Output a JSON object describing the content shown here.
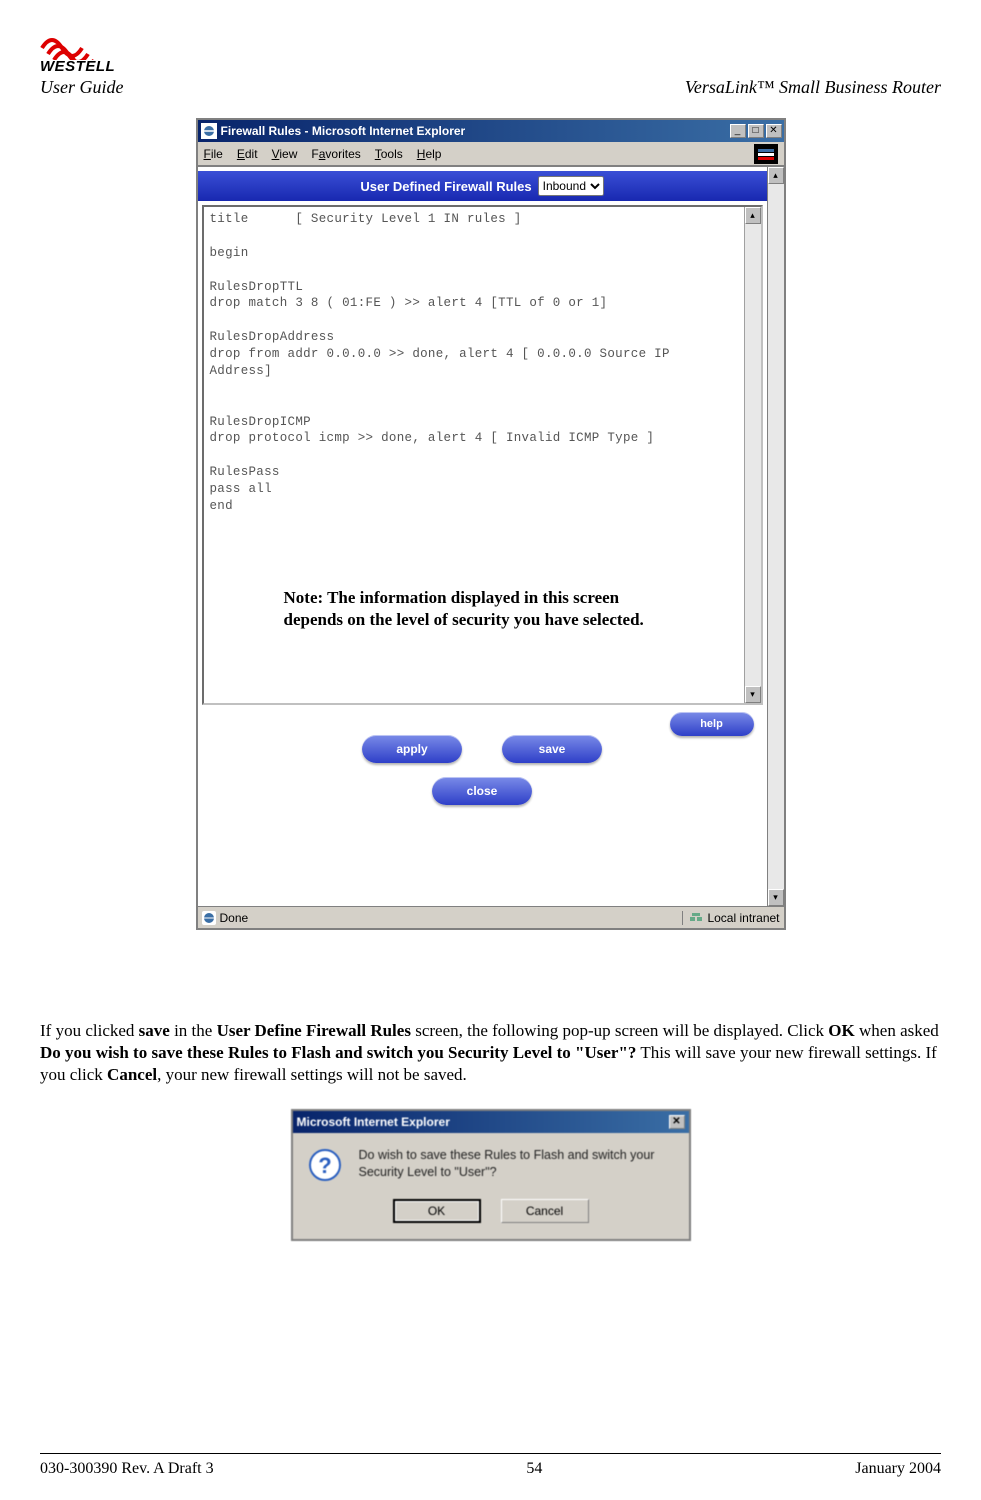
{
  "header": {
    "brand": "WESTELL",
    "user_guide": "User Guide",
    "product": "VersaLink™  Small Business Router"
  },
  "browser": {
    "title": "Firewall Rules - Microsoft Internet Explorer",
    "menu": {
      "file": "File",
      "edit": "Edit",
      "view": "View",
      "favorites": "Favorites",
      "tools": "Tools",
      "help": "Help"
    },
    "status_left": "Done",
    "status_right": "Local intranet"
  },
  "page": {
    "heading": "User Defined Firewall Rules",
    "direction": "Inbound",
    "rules_text": "title      [ Security Level 1 IN rules ]\n\nbegin\n\nRulesDropTTL\ndrop match 3 8 ( 01:FE ) >> alert 4 [TTL of 0 or 1]\n\nRulesDropAddress\ndrop from addr 0.0.0.0 >> done, alert 4 [ 0.0.0.0 Source IP\nAddress]\n\n\nRulesDropICMP\ndrop protocol icmp >> done, alert 4 [ Invalid ICMP Type ]\n\nRulesPass\npass all\nend",
    "note": "Note: The information displayed in this screen depends on the level of security you have selected.",
    "buttons": {
      "apply": "apply",
      "save": "save",
      "close": "close",
      "help": "help"
    }
  },
  "body_paragraph": {
    "p1a": "If you clicked ",
    "p1b": "save",
    "p1c": " in the ",
    "p1d": "User Define Firewall Rules",
    "p1e": " screen, the following pop-up screen will be displayed. Click ",
    "p1f": "OK",
    "p1g": " when asked ",
    "p1h": "Do you wish to save these Rules to Flash and switch you Security Level to \"User\"?",
    "p1i": "  This will save your new firewall settings. If you click ",
    "p1j": "Cancel",
    "p1k": ", your new firewall settings will not be saved."
  },
  "dialog": {
    "title": "Microsoft Internet Explorer",
    "message": "Do wish to save these Rules to Flash and switch your Security Level to \"User\"?",
    "ok": "OK",
    "cancel": "Cancel"
  },
  "footer": {
    "left": "030-300390 Rev. A Draft 3",
    "center": "54",
    "right": "January 2004"
  }
}
